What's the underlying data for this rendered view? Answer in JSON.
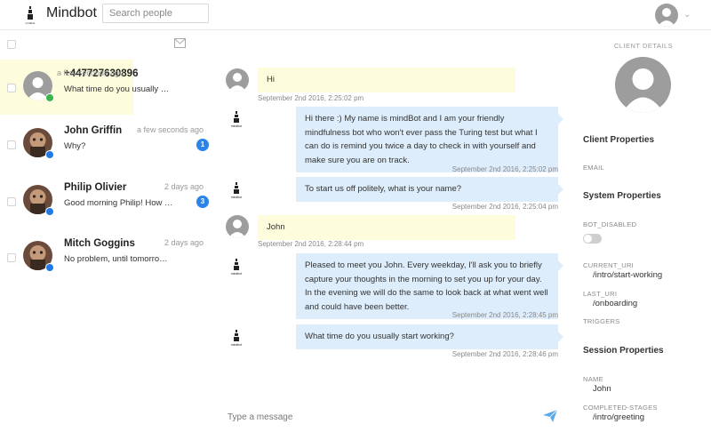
{
  "header": {
    "brand": "Mindbot",
    "search_placeholder": "Search people",
    "user_menu_icon": "chevron-down-icon"
  },
  "list": {
    "conversations": [
      {
        "name": "+447727630896",
        "time": "a few seconds ago",
        "preview": "What time do you usually …",
        "channel": "sms",
        "badge": "",
        "active": true
      },
      {
        "name": "John Griffin",
        "time": "a few seconds ago",
        "preview": "Why?",
        "channel": "messenger",
        "badge": "1",
        "active": false
      },
      {
        "name": "Philip Olivier",
        "time": "2 days ago",
        "preview": "Good morning Philip! How …",
        "channel": "messenger",
        "badge": "3",
        "active": false
      },
      {
        "name": "Mitch Goggins",
        "time": "2 days ago",
        "preview": "No problem, until tomorro…",
        "channel": "messenger",
        "badge": "",
        "active": false
      }
    ]
  },
  "chat": {
    "bot_logo_caption": "mindbot",
    "messages": [
      {
        "from": "user",
        "text": "Hi",
        "time": "September 2nd 2016, 2:25:02 pm"
      },
      {
        "from": "bot",
        "text": "Hi there :) My name is mindBot and I am your friendly mindfulness bot who won't ever pass the Turing test but what I can do is remind you twice a day to check in with yourself and make sure you are on track.",
        "time": "September 2nd 2016, 2:25:02 pm"
      },
      {
        "from": "bot",
        "text": "To start us off politely, what is your name?",
        "time": "September 2nd 2016, 2:25:04 pm"
      },
      {
        "from": "user",
        "text": "John",
        "time": "September 2nd 2016, 2:28:44 pm"
      },
      {
        "from": "bot",
        "text": "Pleased to meet you John. Every weekday, I'll ask you to briefly capture your thoughts in the morning to set you up for your day. In the evening we will do the same to look back at what went well and could have been better.",
        "time": "September 2nd 2016, 2:28:45 pm"
      },
      {
        "from": "bot",
        "text": "What time do you usually start working?",
        "time": "September 2nd 2016, 2:28:46 pm"
      }
    ],
    "composer_placeholder": "Type a message"
  },
  "details": {
    "title": "CLIENT DETAILS",
    "client_properties": "Client Properties",
    "email_label": "EMAIL",
    "system_properties": "System Properties",
    "bot_disabled_label": "BOT_DISABLED",
    "bot_disabled": false,
    "current_uri_label": "CURRENT_URI",
    "current_uri": "/intro/start-working",
    "last_uri_label": "LAST_URI",
    "last_uri": "/onboarding",
    "triggers_label": "TRIGGERS",
    "session_properties": "Session Properties",
    "name_label": "NAME",
    "name": "John",
    "completed_stages_label": "COMPLETED-STAGES",
    "completed_stages": "/intro/greeting"
  },
  "colors": {
    "user_bubble": "#fdfdde",
    "bot_bubble": "#ddedfb",
    "badge": "#2b84e8",
    "sms_channel": "#3bb54a",
    "messenger_channel": "#1f7ae8"
  }
}
